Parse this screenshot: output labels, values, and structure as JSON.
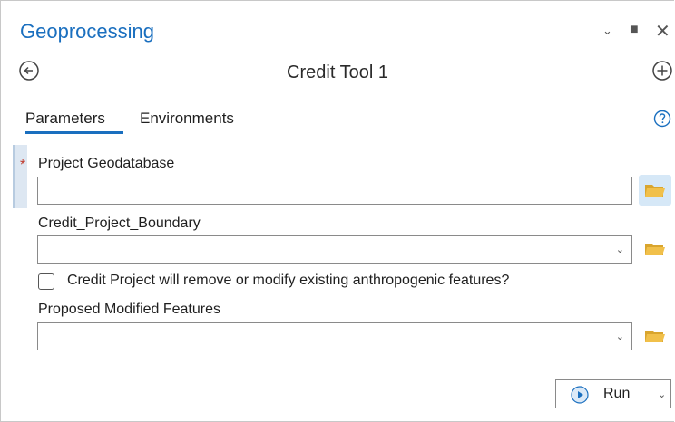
{
  "panel": {
    "title": "Geoprocessing",
    "window_controls": {
      "collapse": "⌄",
      "maximize": "■",
      "close": "✕"
    },
    "tool_name": "Credit Tool 1",
    "nav": {
      "back_icon": "arrow-left-circle-icon",
      "add_icon": "plus-circle-icon"
    }
  },
  "tabs": [
    {
      "label": "Parameters",
      "active": true
    },
    {
      "label": "Environments",
      "active": false
    }
  ],
  "help_icon": "question-circle-icon",
  "params": {
    "required_marker": "*",
    "project_geodatabase": {
      "label": "Project Geodatabase",
      "value": ""
    },
    "credit_project_boundary": {
      "label": "Credit_Project_Boundary",
      "value": ""
    },
    "modify_checkbox": {
      "label": "Credit Project will remove or modify existing anthropogenic features?",
      "checked": false
    },
    "proposed_modified_features": {
      "label": "Proposed Modified Features",
      "value": ""
    }
  },
  "dropdown_glyph": "⌄",
  "run_button": {
    "label": "Run",
    "icon": "play-circle-icon"
  },
  "colors": {
    "accent": "#1a6fbf",
    "required": "#c0392b",
    "folder": "#e8b53a"
  }
}
